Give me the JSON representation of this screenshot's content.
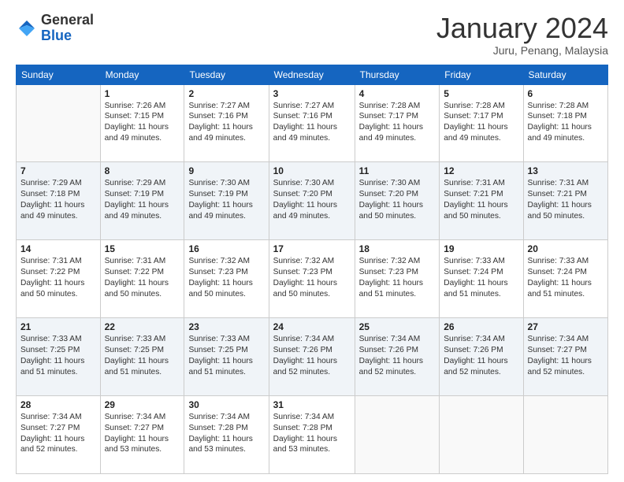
{
  "header": {
    "logo_general": "General",
    "logo_blue": "Blue",
    "title": "January 2024",
    "subtitle": "Juru, Penang, Malaysia"
  },
  "columns": [
    "Sunday",
    "Monday",
    "Tuesday",
    "Wednesday",
    "Thursday",
    "Friday",
    "Saturday"
  ],
  "weeks": [
    [
      {
        "day": "",
        "info": ""
      },
      {
        "day": "1",
        "info": "Sunrise: 7:26 AM\nSunset: 7:15 PM\nDaylight: 11 hours and 49 minutes."
      },
      {
        "day": "2",
        "info": "Sunrise: 7:27 AM\nSunset: 7:16 PM\nDaylight: 11 hours and 49 minutes."
      },
      {
        "day": "3",
        "info": "Sunrise: 7:27 AM\nSunset: 7:16 PM\nDaylight: 11 hours and 49 minutes."
      },
      {
        "day": "4",
        "info": "Sunrise: 7:28 AM\nSunset: 7:17 PM\nDaylight: 11 hours and 49 minutes."
      },
      {
        "day": "5",
        "info": "Sunrise: 7:28 AM\nSunset: 7:17 PM\nDaylight: 11 hours and 49 minutes."
      },
      {
        "day": "6",
        "info": "Sunrise: 7:28 AM\nSunset: 7:18 PM\nDaylight: 11 hours and 49 minutes."
      }
    ],
    [
      {
        "day": "7",
        "info": "Sunrise: 7:29 AM\nSunset: 7:18 PM\nDaylight: 11 hours and 49 minutes."
      },
      {
        "day": "8",
        "info": "Sunrise: 7:29 AM\nSunset: 7:19 PM\nDaylight: 11 hours and 49 minutes."
      },
      {
        "day": "9",
        "info": "Sunrise: 7:30 AM\nSunset: 7:19 PM\nDaylight: 11 hours and 49 minutes."
      },
      {
        "day": "10",
        "info": "Sunrise: 7:30 AM\nSunset: 7:20 PM\nDaylight: 11 hours and 49 minutes."
      },
      {
        "day": "11",
        "info": "Sunrise: 7:30 AM\nSunset: 7:20 PM\nDaylight: 11 hours and 50 minutes."
      },
      {
        "day": "12",
        "info": "Sunrise: 7:31 AM\nSunset: 7:21 PM\nDaylight: 11 hours and 50 minutes."
      },
      {
        "day": "13",
        "info": "Sunrise: 7:31 AM\nSunset: 7:21 PM\nDaylight: 11 hours and 50 minutes."
      }
    ],
    [
      {
        "day": "14",
        "info": "Sunrise: 7:31 AM\nSunset: 7:22 PM\nDaylight: 11 hours and 50 minutes."
      },
      {
        "day": "15",
        "info": "Sunrise: 7:31 AM\nSunset: 7:22 PM\nDaylight: 11 hours and 50 minutes."
      },
      {
        "day": "16",
        "info": "Sunrise: 7:32 AM\nSunset: 7:23 PM\nDaylight: 11 hours and 50 minutes."
      },
      {
        "day": "17",
        "info": "Sunrise: 7:32 AM\nSunset: 7:23 PM\nDaylight: 11 hours and 50 minutes."
      },
      {
        "day": "18",
        "info": "Sunrise: 7:32 AM\nSunset: 7:23 PM\nDaylight: 11 hours and 51 minutes."
      },
      {
        "day": "19",
        "info": "Sunrise: 7:33 AM\nSunset: 7:24 PM\nDaylight: 11 hours and 51 minutes."
      },
      {
        "day": "20",
        "info": "Sunrise: 7:33 AM\nSunset: 7:24 PM\nDaylight: 11 hours and 51 minutes."
      }
    ],
    [
      {
        "day": "21",
        "info": "Sunrise: 7:33 AM\nSunset: 7:25 PM\nDaylight: 11 hours and 51 minutes."
      },
      {
        "day": "22",
        "info": "Sunrise: 7:33 AM\nSunset: 7:25 PM\nDaylight: 11 hours and 51 minutes."
      },
      {
        "day": "23",
        "info": "Sunrise: 7:33 AM\nSunset: 7:25 PM\nDaylight: 11 hours and 51 minutes."
      },
      {
        "day": "24",
        "info": "Sunrise: 7:34 AM\nSunset: 7:26 PM\nDaylight: 11 hours and 52 minutes."
      },
      {
        "day": "25",
        "info": "Sunrise: 7:34 AM\nSunset: 7:26 PM\nDaylight: 11 hours and 52 minutes."
      },
      {
        "day": "26",
        "info": "Sunrise: 7:34 AM\nSunset: 7:26 PM\nDaylight: 11 hours and 52 minutes."
      },
      {
        "day": "27",
        "info": "Sunrise: 7:34 AM\nSunset: 7:27 PM\nDaylight: 11 hours and 52 minutes."
      }
    ],
    [
      {
        "day": "28",
        "info": "Sunrise: 7:34 AM\nSunset: 7:27 PM\nDaylight: 11 hours and 52 minutes."
      },
      {
        "day": "29",
        "info": "Sunrise: 7:34 AM\nSunset: 7:27 PM\nDaylight: 11 hours and 53 minutes."
      },
      {
        "day": "30",
        "info": "Sunrise: 7:34 AM\nSunset: 7:28 PM\nDaylight: 11 hours and 53 minutes."
      },
      {
        "day": "31",
        "info": "Sunrise: 7:34 AM\nSunset: 7:28 PM\nDaylight: 11 hours and 53 minutes."
      },
      {
        "day": "",
        "info": ""
      },
      {
        "day": "",
        "info": ""
      },
      {
        "day": "",
        "info": ""
      }
    ]
  ]
}
